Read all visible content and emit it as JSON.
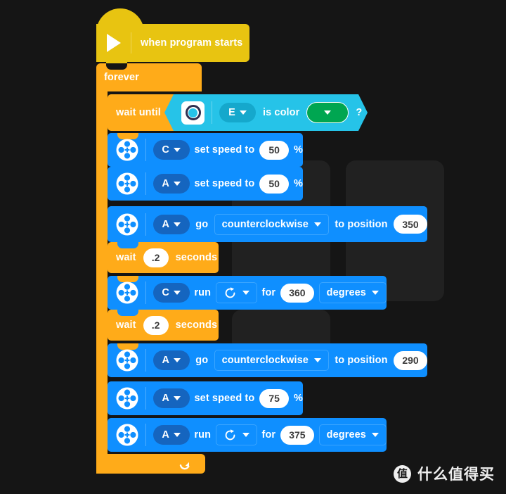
{
  "theme": {
    "background": "#151515",
    "hat_yellow": "#e8c411",
    "control_orange": "#ffab19",
    "motor_blue": "#0f8fff",
    "motor_pill_blue": "#1565bf",
    "sensor_cyan": "#26c3e8",
    "sensor_pill_cyan": "#15a8cc",
    "color_green": "#00a651",
    "field_white": "#ffffff",
    "field_text": "#3b3b3b"
  },
  "program": {
    "hat": {
      "icon": "play-icon",
      "label": "when program starts"
    },
    "forever": {
      "label": "forever",
      "loop_icon": "loop-arrow-icon"
    },
    "wait_until": {
      "label": "wait until",
      "condition": {
        "sensor_icon": "color-sensor-icon",
        "port": "E",
        "port_caret": "chevron-down-icon",
        "text": "is color",
        "color_value_icon": "chevron-down-icon",
        "color_value": "green",
        "question": "?"
      }
    },
    "blocks": [
      {
        "kind": "motor-set-speed",
        "icon": "motor-icon",
        "port": "C",
        "text_before": "set speed to",
        "value": "50",
        "unit": "%"
      },
      {
        "kind": "motor-set-speed",
        "icon": "motor-icon",
        "port": "A",
        "text_before": "set speed to",
        "value": "50",
        "unit": "%"
      },
      {
        "kind": "motor-go-to-position",
        "icon": "motor-icon",
        "port": "A",
        "text_before": "go",
        "direction": "counterclockwise",
        "text_mid": "to position",
        "value": "350"
      },
      {
        "kind": "wait-seconds",
        "text_before": "wait",
        "value": ".2",
        "text_after": "seconds"
      },
      {
        "kind": "motor-run-for",
        "icon": "motor-icon",
        "port": "C",
        "text_before": "run",
        "direction_icon": "rotate-clockwise-icon",
        "text_mid": "for",
        "value": "360",
        "unit_dropdown": "degrees"
      },
      {
        "kind": "wait-seconds",
        "text_before": "wait",
        "value": ".2",
        "text_after": "seconds"
      },
      {
        "kind": "motor-go-to-position",
        "icon": "motor-icon",
        "port": "A",
        "text_before": "go",
        "direction": "counterclockwise",
        "text_mid": "to position",
        "value": "290"
      },
      {
        "kind": "motor-set-speed",
        "icon": "motor-icon",
        "port": "A",
        "text_before": "set speed to",
        "value": "75",
        "unit": "%"
      },
      {
        "kind": "motor-run-for",
        "icon": "motor-icon",
        "port": "A",
        "text_before": "run",
        "direction_icon": "rotate-clockwise-icon",
        "text_mid": "for",
        "value": "375",
        "unit_dropdown": "degrees"
      }
    ]
  },
  "watermark": {
    "logo_char": "值",
    "text": "什么值得买"
  }
}
